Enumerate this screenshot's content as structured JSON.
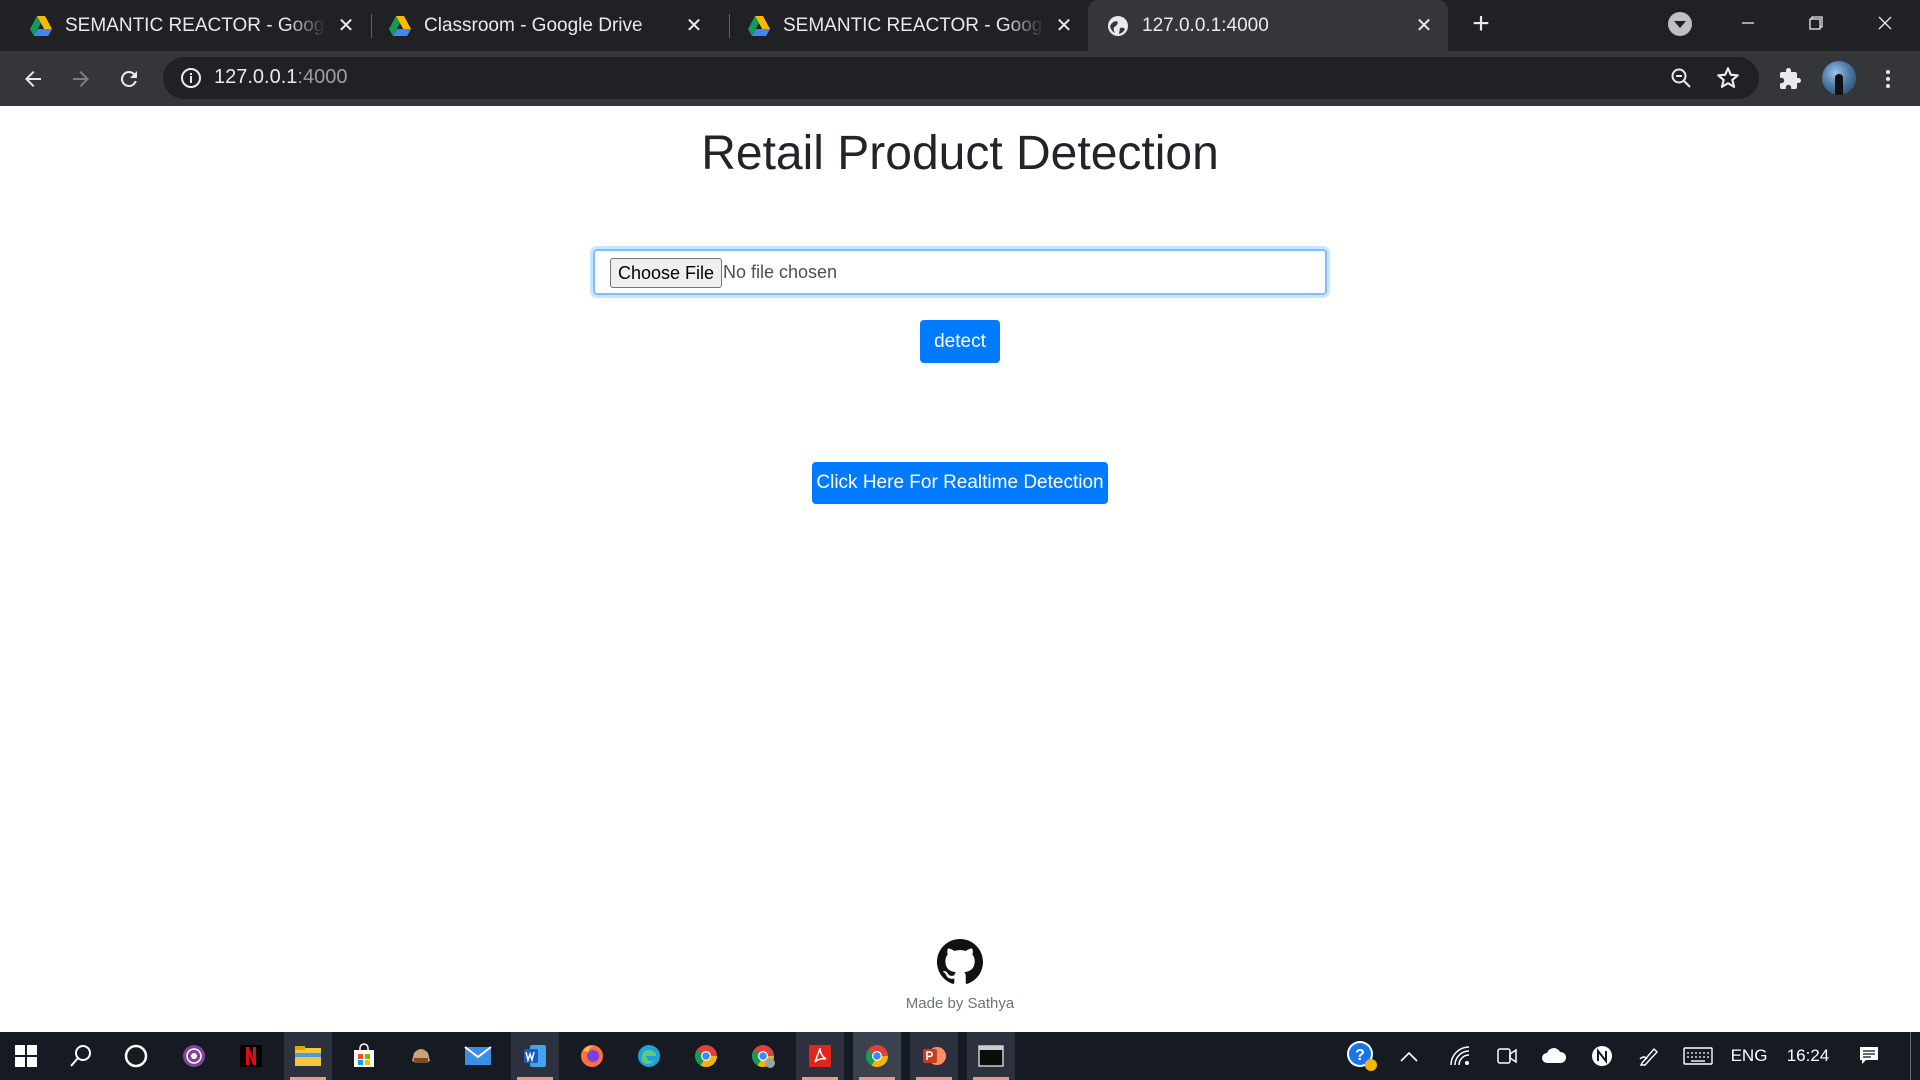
{
  "browser": {
    "tabs": [
      {
        "title": "SEMANTIC REACTOR - Google Drive",
        "icon": "google-drive-icon",
        "active": false
      },
      {
        "title": "Classroom - Google Drive",
        "icon": "google-drive-icon",
        "active": false
      },
      {
        "title": "SEMANTIC REACTOR - Google Drive",
        "icon": "google-drive-icon",
        "active": false
      },
      {
        "title": "127.0.0.1:4000",
        "icon": "globe-icon",
        "active": true
      }
    ],
    "url_host": "127.0.0.1",
    "url_port": ":4000"
  },
  "page": {
    "title": "Retail Product Detection",
    "file_button_label": "Choose File",
    "file_status": "No file chosen",
    "detect_label": "detect",
    "realtime_label": "Click Here For Realtime Detection",
    "footer": "Made by Sathya"
  },
  "taskbar": {
    "language": "ENG",
    "time": "16:24"
  },
  "colors": {
    "primary": "#007bff",
    "chrome_dark": "#202124",
    "chrome_toolbar": "#35363a",
    "taskbar": "#161a23"
  }
}
